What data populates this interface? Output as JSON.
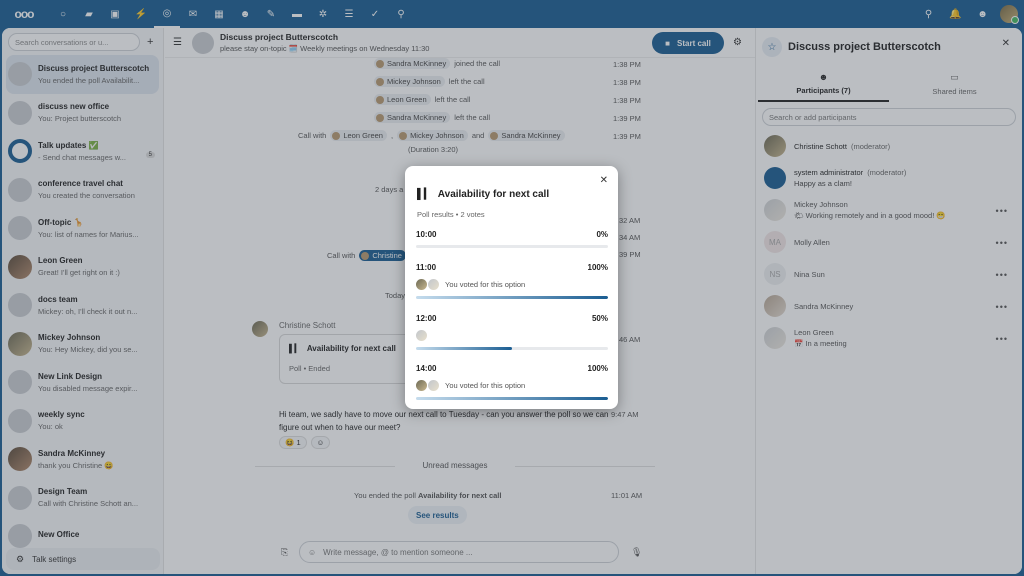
{
  "topbar": {
    "logo": "ooo",
    "apps": [
      {
        "icon": "dashboard-icon",
        "glyph": "○"
      },
      {
        "icon": "files-icon",
        "glyph": "▰"
      },
      {
        "icon": "photos-icon",
        "glyph": "▣"
      },
      {
        "icon": "activity-icon",
        "glyph": "⚡"
      },
      {
        "icon": "talk-icon",
        "glyph": "◎"
      },
      {
        "icon": "mail-icon",
        "glyph": "✉"
      },
      {
        "icon": "calendar-icon",
        "glyph": "▦"
      },
      {
        "icon": "contacts-icon",
        "glyph": "☻"
      },
      {
        "icon": "notes-icon",
        "glyph": "✎"
      },
      {
        "icon": "deck-icon",
        "glyph": "▬"
      },
      {
        "icon": "spreed-icon",
        "glyph": "✲"
      },
      {
        "icon": "tasks-list-icon",
        "glyph": "☰"
      },
      {
        "icon": "checklist-icon",
        "glyph": "✓"
      },
      {
        "icon": "maps-icon",
        "glyph": "⚲"
      }
    ],
    "right": [
      {
        "icon": "search-icon",
        "glyph": "⚲"
      },
      {
        "icon": "notifications-icon",
        "glyph": "🔔"
      },
      {
        "icon": "contacts-menu-icon",
        "glyph": "☻"
      }
    ]
  },
  "left": {
    "search_placeholder": "Search conversations or u...",
    "conversations": [
      {
        "title": "Discuss project Butterscotch",
        "sub": "You ended the poll Availabilit...",
        "avatar": "link",
        "active": true
      },
      {
        "title": "discuss new office",
        "sub": "You: Project butterscotch",
        "avatar": "link"
      },
      {
        "title": "Talk updates ✅",
        "sub": "- Send chat messages w...",
        "avatar": "talk",
        "badge": "5"
      },
      {
        "title": "conference travel chat",
        "sub": "You created the conversation",
        "avatar": "link"
      },
      {
        "title": "Off-topic 🦒",
        "sub": "You: list of names for Marius...",
        "avatar": "link"
      },
      {
        "title": "Leon Green",
        "sub": "Great! I'll get right on it :)",
        "avatar": "photo2"
      },
      {
        "title": "docs team",
        "sub": "Mickey: oh, I'll check it out n...",
        "avatar": "link"
      },
      {
        "title": "Mickey Johnson",
        "sub": "You: Hey Mickey, did you se...",
        "avatar": "photo1"
      },
      {
        "title": "New Link Design",
        "sub": "You disabled message expir...",
        "avatar": "link"
      },
      {
        "title": "weekly sync",
        "sub": "You: ok",
        "avatar": "link"
      },
      {
        "title": "Sandra McKinney",
        "sub": "thank you Christine 😀",
        "avatar": "photo2"
      },
      {
        "title": "Design Team",
        "sub": "Call with Christine Schott an...",
        "avatar": "link"
      },
      {
        "title": "New Office",
        "sub": "",
        "avatar": "link"
      }
    ],
    "settings_label": "Talk settings"
  },
  "chat": {
    "title": "Discuss project Butterscotch",
    "subtitle": "please stay on-topic 🗓️ Weekly meetings on Wednesday 11:30",
    "start_call": "Start call",
    "system": [
      {
        "who": "Sandra McKinney",
        "text": "joined the call",
        "time": "1:38 PM"
      },
      {
        "who": "Mickey Johnson",
        "text": "left the call",
        "time": "1:38 PM"
      },
      {
        "who": "Leon Green",
        "text": "left the call",
        "time": "1:38 PM"
      },
      {
        "who": "Sandra McKinney",
        "text": "left the call",
        "time": "1:39 PM"
      }
    ],
    "call_summary": {
      "prefix": "Call with",
      "p1": "Leon Green",
      "p2": "Mickey Johnson",
      "and": "and",
      "p3": "Sandra McKinney",
      "duration": "(Duration 3:20)",
      "time": "1:39 PM"
    },
    "partial": {
      "days_ago": "2 days a",
      "t1": "32 AM",
      "t2": "34 AM",
      "call_with": "Call with",
      "christine": "Christine",
      "t3": "39 PM",
      "today": "Today",
      "t4": "46 AM"
    },
    "author": "Christine Schott",
    "poll_card": {
      "title": "Availability for next call",
      "status": "Poll  •  Ended"
    },
    "message": "Hi team, we sadly have to move our next call to Tuesday - can you answer the poll so we can figure out when to have our meet?",
    "message_time": "9:47 AM",
    "reaction": {
      "emoji": "😆",
      "count": "1"
    },
    "unread": "Unread messages",
    "poll_end": {
      "prefix": "You ended the poll",
      "name": "Availability for next call",
      "time": "11:01 AM"
    },
    "see_results": "See results",
    "composer_placeholder": "Write message, @ to mention someone ..."
  },
  "right": {
    "title": "Discuss project Butterscotch",
    "tabs": [
      {
        "label": "Participants (7)",
        "active": true
      },
      {
        "label": "Shared items",
        "active": false
      }
    ],
    "search_placeholder": "Search or add participants",
    "participants": [
      {
        "name": "Christine Schott",
        "role": "(moderator)",
        "status": "",
        "avatar": "photo1",
        "more": false
      },
      {
        "name": "system administrator",
        "role": "(moderator)",
        "status": "Happy as a clam!",
        "avatar": "talk",
        "more": false
      },
      {
        "name": "Mickey Johnson",
        "role": "",
        "status": "🌤 Working remotely and in a good mood! 😁",
        "avatar": "photo3",
        "more": true
      },
      {
        "name": "Molly Allen",
        "role": "",
        "status": "",
        "avatar": "MA",
        "more": true
      },
      {
        "name": "Nina Sun",
        "role": "",
        "status": "",
        "avatar": "NS",
        "more": true
      },
      {
        "name": "Sandra McKinney",
        "role": "",
        "status": "",
        "avatar": "photo2",
        "more": true
      },
      {
        "name": "Leon Green",
        "role": "",
        "status": "📅 In a meeting",
        "avatar": "photo3",
        "more": true
      }
    ]
  },
  "modal": {
    "title": "Availability for next call",
    "subtitle": "Poll results • 2 votes",
    "options": [
      {
        "label": "10:00",
        "percent_label": "0%",
        "percent": 0,
        "voters": 0,
        "voted_text": ""
      },
      {
        "label": "11:00",
        "percent_label": "100%",
        "percent": 100,
        "voters": 2,
        "voted_text": "You voted for this option"
      },
      {
        "label": "12:00",
        "percent_label": "50%",
        "percent": 50,
        "voters": 1,
        "voted_text": ""
      },
      {
        "label": "14:00",
        "percent_label": "100%",
        "percent": 100,
        "voters": 2,
        "voted_text": "You voted for this option"
      }
    ]
  }
}
